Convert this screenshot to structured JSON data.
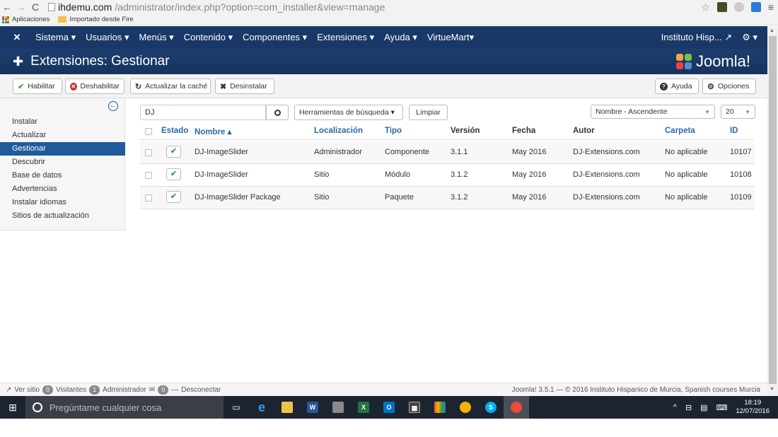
{
  "browser": {
    "url_host": "ihdemu.com",
    "url_path": "/administrator/index.php?option=com_installer&view=manage",
    "bookmarks": [
      "Aplicaciones",
      "Importado desde Fire"
    ]
  },
  "topnav": {
    "menu": [
      "Sistema ▾",
      "Usuarios ▾",
      "Menús ▾",
      "Contenido ▾",
      "Componentes ▾",
      "Extensiones ▾",
      "Ayuda ▾",
      "VirtueMart▾"
    ],
    "site_name": "Instituto Hisp...",
    "gear": "⚙ ▾"
  },
  "header": {
    "title": "Extensiones: Gestionar",
    "brand": "Joomla!"
  },
  "toolbar": {
    "enable": "Habilitar",
    "disable": "Deshabilitar",
    "refresh_cache": "Actualizar la caché",
    "uninstall": "Desinstalar",
    "help": "Ayuda",
    "options": "Opciones"
  },
  "sidebar": {
    "items": [
      "Instalar",
      "Actualizar",
      "Gestionar",
      "Descubrir",
      "Base de datos",
      "Advertencias",
      "Instalar idiomas",
      "Sitios de actualización"
    ],
    "active": "Gestionar"
  },
  "filters": {
    "search_value": "DJ",
    "search_tools": "Herramientas de búsqueda ▾",
    "clear": "Limpiar",
    "sort": "Nombre - Ascendente",
    "limit": "20"
  },
  "table": {
    "headers": [
      "Estado",
      "Nombre ▴",
      "Localización",
      "Tipo",
      "Versión",
      "Fecha",
      "Autor",
      "Carpeta",
      "ID"
    ],
    "rows": [
      [
        "DJ-ImageSlider",
        "Administrador",
        "Componente",
        "3.1.1",
        "May 2016",
        "DJ-Extensions.com",
        "No aplicable",
        "10107"
      ],
      [
        "DJ-ImageSlider",
        "Sitio",
        "Módulo",
        "3.1.2",
        "May 2016",
        "DJ-Extensions.com",
        "No aplicable",
        "10108"
      ],
      [
        "DJ-ImageSlider Package",
        "Sitio",
        "Paquete",
        "3.1.2",
        "May 2016",
        "DJ-Extensions.com",
        "No aplicable",
        "10109"
      ]
    ]
  },
  "statusbar": {
    "view_site": "Ver sitio",
    "visitors_count": "0",
    "visitors": "Visitantes",
    "admins_count": "1",
    "admins": "Administrador",
    "messages_count": "0",
    "logout": "Desconectar",
    "copyright": "Joomla! 3.5.1 — © 2016 Instituto Hispanico de Murcia, Spanish courses Murcia"
  },
  "taskbar": {
    "search_placeholder": "Pregúntame cualquier cosa",
    "time": "18:19",
    "date": "12/07/2016"
  },
  "colors": {
    "nav_bg": "#1a3867",
    "active_item": "#1f5b9b",
    "link": "#2a6aa8",
    "enabled_green": "#46a546"
  }
}
